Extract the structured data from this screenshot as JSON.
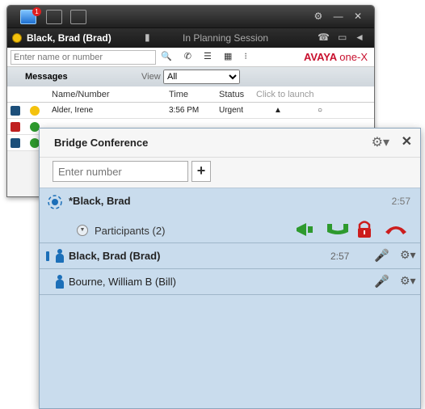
{
  "back_window": {
    "badge_count": "1",
    "status_name": "Black, Brad (Brad)",
    "status_activity": "In Planning Session",
    "search_placeholder": "Enter name or number",
    "logo_avaya": "AVAYA",
    "logo_product": "one-X",
    "messages_label": "Messages",
    "view_label": "View",
    "view_value": "All",
    "columns": [
      "Name/Number",
      "Time",
      "Status",
      "Click to launch"
    ],
    "rows": [
      {
        "name": "Alder, Irene",
        "time": "3:56 PM",
        "status": "Urgent"
      }
    ]
  },
  "bridge": {
    "title": "Bridge Conference",
    "input_placeholder": "Enter number",
    "conference_name": "*Black, Brad",
    "conference_time": "2:57",
    "participants_label": "Participants (2)",
    "participants": [
      {
        "name": "Black, Brad (Brad)",
        "time": "2:57",
        "bold": true
      },
      {
        "name": "Bourne, William B (Bill)",
        "time": "",
        "bold": false
      }
    ]
  },
  "colors": {
    "accent_blue": "#1c6fb8",
    "mic_green": "#2e9a2e",
    "avaya_red": "#c8102e",
    "hangup_red": "#cc1d1d"
  }
}
